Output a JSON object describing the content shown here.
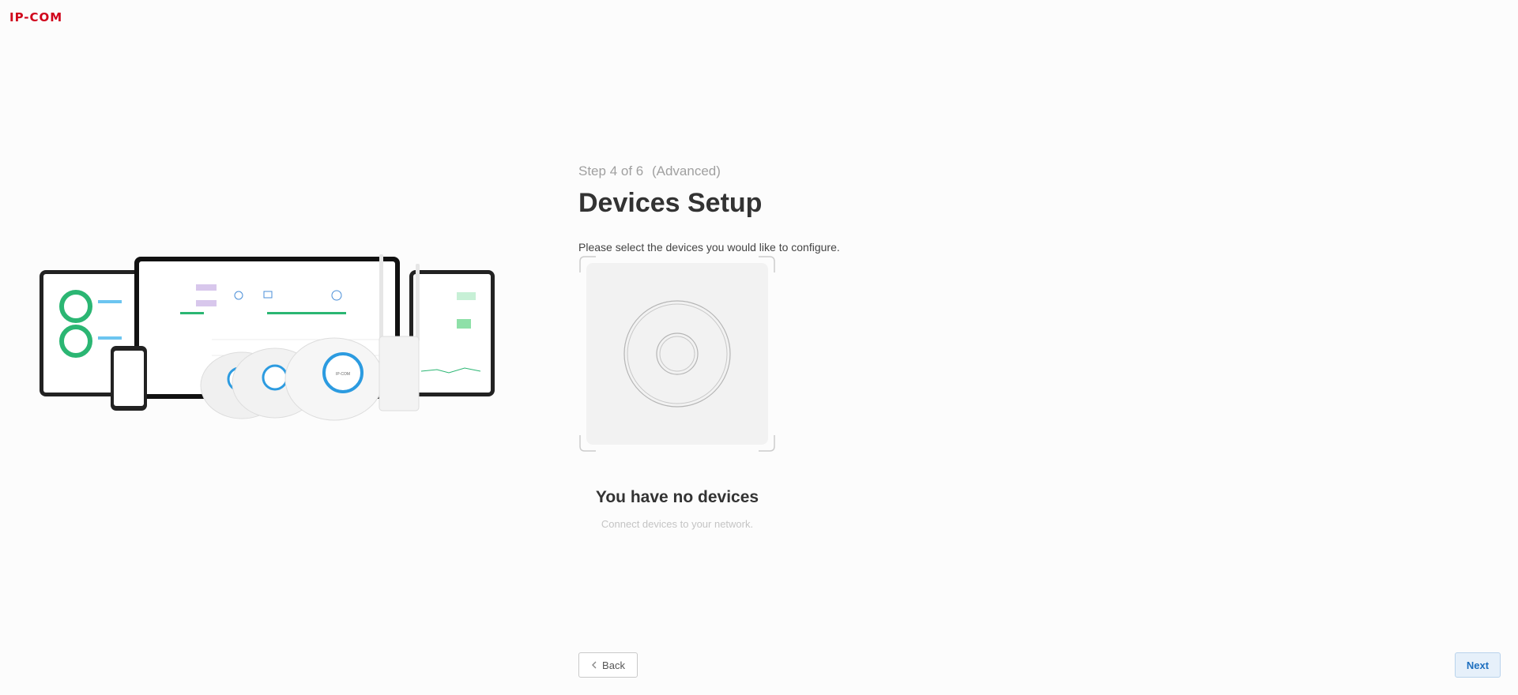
{
  "brand": {
    "logo_text": "IP-COM",
    "accent_color": "#d0021b"
  },
  "hero": {
    "logo_text": "IP-COM"
  },
  "wizard": {
    "step_text": "Step 4 of 6",
    "step_mode": "(Advanced)",
    "title": "Devices Setup",
    "instruction": "Please select the devices you would like to configure."
  },
  "empty_state": {
    "icon": "ceiling-access-point-icon",
    "title": "You have no devices",
    "description": "Connect devices to your network."
  },
  "footer": {
    "back_label": "Back",
    "back_icon": "chevron-left-icon",
    "next_label": "Next",
    "next_color": "#1e6fbf"
  }
}
